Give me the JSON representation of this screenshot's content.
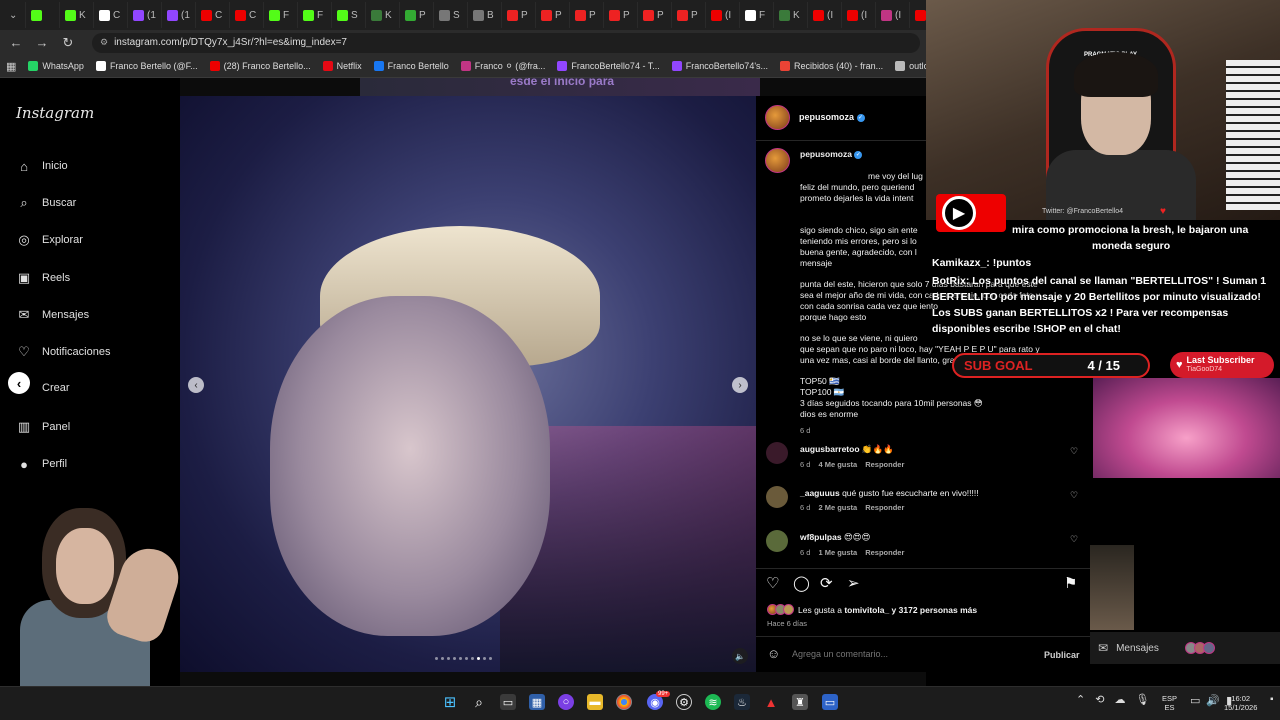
{
  "browser": {
    "tabs": [
      {
        "label": "",
        "color": "#53fc18"
      },
      {
        "label": "K",
        "color": "#53fc18"
      },
      {
        "label": "C",
        "color": "#ffffff"
      },
      {
        "label": "(1",
        "color": "#9146ff"
      },
      {
        "label": "(1",
        "color": "#9146ff"
      },
      {
        "label": "C",
        "color": "#e00"
      },
      {
        "label": "C",
        "color": "#e00"
      },
      {
        "label": "F",
        "color": "#53fc18"
      },
      {
        "label": "F",
        "color": "#53fc18"
      },
      {
        "label": "S",
        "color": "#53fc18"
      },
      {
        "label": "K",
        "color": "#3a7a3a"
      },
      {
        "label": "P",
        "color": "#33aa33"
      },
      {
        "label": "S",
        "color": "#777"
      },
      {
        "label": "B",
        "color": "#777"
      },
      {
        "label": "P",
        "color": "#e22"
      },
      {
        "label": "P",
        "color": "#e22"
      },
      {
        "label": "P",
        "color": "#e22"
      },
      {
        "label": "P",
        "color": "#e22"
      },
      {
        "label": "P",
        "color": "#e22"
      },
      {
        "label": "P",
        "color": "#e22"
      },
      {
        "label": "(I",
        "color": "#e00"
      },
      {
        "label": "F",
        "color": "#ffffff"
      },
      {
        "label": "K",
        "color": "#3a7a3a"
      },
      {
        "label": "(I",
        "color": "#e00"
      },
      {
        "label": "(I",
        "color": "#e00"
      },
      {
        "label": "(I",
        "color": "#c13584"
      },
      {
        "label": "S",
        "color": "#e00"
      },
      {
        "label": "(I",
        "color": "#e00"
      }
    ],
    "url": "instagram.com/p/DTQy7x_j4Sr/?hl=es&img_index=7",
    "bookmarks": [
      {
        "label": "WhatsApp",
        "color": "#25d366"
      },
      {
        "label": "Franco Bertello (@F...",
        "color": "#ffffff"
      },
      {
        "label": "(28) Franco Bertello...",
        "color": "#e00"
      },
      {
        "label": "Netflix",
        "color": "#e50914"
      },
      {
        "label": "Franco Bertello",
        "color": "#1877f2"
      },
      {
        "label": "Franco ⚪ (@fra...",
        "color": "#c13584"
      },
      {
        "label": "FrancoBertello74 - T...",
        "color": "#9146ff"
      },
      {
        "label": "FrancoBertello74's...",
        "color": "#9146ff"
      },
      {
        "label": "Recibidos (40) - fran...",
        "color": "#ea4335"
      },
      {
        "label": "outlook",
        "color": "#bbbbbb"
      },
      {
        "label": "Aler",
        "color": "#53fc18"
      }
    ]
  },
  "sidebar": {
    "logo": "Instagram",
    "items": [
      {
        "label": "Inicio",
        "icon": "⌂"
      },
      {
        "label": "Buscar",
        "icon": "⌕"
      },
      {
        "label": "Explorar",
        "icon": "◎"
      },
      {
        "label": "Reels",
        "icon": "▣"
      },
      {
        "label": "Mensajes",
        "icon": "✉"
      },
      {
        "label": "Notificaciones",
        "icon": "♡"
      },
      {
        "label": "Crear",
        "icon": "⊕"
      },
      {
        "label": "Panel",
        "icon": "▥"
      },
      {
        "label": "Perfil",
        "icon": "●"
      }
    ]
  },
  "post": {
    "username": "pepusomoza",
    "caption_p1": "me voy del lug\nfeliz del mundo, pero queriend\nprometo dejarles la vida intent",
    "caption_p2": "sigo siendo chico, sigo sin ente\nteniendo mis errores, pero si lo\nbuena gente, agradecido, con l\nmensaje",
    "caption_p3": "punta del este, hicieron que solo 7 días bastaran para que este\nsea el mejor año de mi vida, con cada mensaje, con cada foto y\ncon cada sonrisa cada vez que                                 iento\nporque hago esto",
    "caption_p4": "no se lo que se viene, ni quiero\nque sepan que no paro ni loco, hay \"YEAH P E P U\" para rato y\nuna vez mas, casi al borde del llanto, gracias de corazón 🫶🫶",
    "caption_p5": "TOP50 🇺🇾\nTOP100 🇦🇷\n3 días seguidos tocando para 10mil personas 😳\ndios es enorme",
    "caption_age": "6 d",
    "comments": [
      {
        "user": "augusbarretoo",
        "text": "👏🔥🔥",
        "age": "6 d",
        "likes": "4 Me gusta",
        "reply": "Responder"
      },
      {
        "user": "_aaguuus",
        "text": "qué gusto fue escucharte en vivo!!!!!",
        "age": "6 d",
        "likes": "2 Me gusta",
        "reply": "Responder"
      },
      {
        "user": "wf8pulpas",
        "text": "😍😍😍",
        "age": "6 d",
        "likes": "1 Me gusta",
        "reply": "Responder"
      }
    ],
    "likes_prefix": "Les gusta a ",
    "likes_user": "tomivitola_",
    "likes_suffix": " y 3172 personas más",
    "post_age": "Hace 6 días",
    "comment_placeholder": "Agrega un comentario...",
    "publish_label": "Publicar",
    "top_banner_text": "esde el inicio para"
  },
  "stream": {
    "twitter_handle": "Twitter: @FrancoBertello4",
    "chat": [
      {
        "text": "mira como promociona la bresh, le bajaron una moneda seguro"
      },
      {
        "text": "Kamikazx_: !puntos"
      },
      {
        "text": "BotRix: Los puntos del canal se llaman \"BERTELLITOS\" ! Suman 1 BERTELLITO por mensaje y 20 Bertellitos por minuto visualizado! Los SUBS ganan BERTELLITOS x2 ! Para ver recompensas disponibles escribe !SHOP en el chat!"
      }
    ],
    "sub_goal_label": "SUB GOAL",
    "sub_goal_value": "4 / 15",
    "last_sub_title": "Last Subscriber",
    "last_sub_name": "TiaGooD74",
    "msg_label": "Mensajes",
    "cam_brand": "PRAGMATIC PLAY"
  },
  "taskbar": {
    "lang_top": "ESP",
    "lang_bottom": "ES",
    "time": "16:02",
    "date": "15/1/2026",
    "badge": "99+"
  },
  "colors": {
    "accent_blue": "#0095f6",
    "verified": "#3897f0",
    "stream_red": "#d41a2a"
  }
}
